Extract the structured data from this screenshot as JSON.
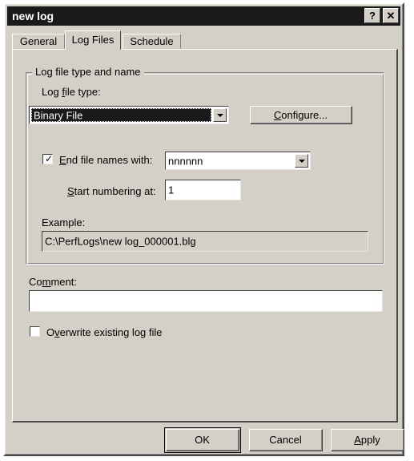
{
  "window": {
    "title": "new log",
    "help_button": "?",
    "close_button": "✕"
  },
  "tabs": [
    {
      "label": "General",
      "selected": false
    },
    {
      "label": "Log Files",
      "selected": true
    },
    {
      "label": "Schedule",
      "selected": false
    }
  ],
  "group": {
    "title": "Log file type and name",
    "log_file_type_label": "Log file type:",
    "log_file_type_value": "Binary File",
    "configure_button": "Configure...",
    "end_file_names_label": "End file names with:",
    "end_file_names_checked": true,
    "suffix_value": "nnnnnn",
    "start_numbering_label": "Start numbering at:",
    "start_numbering_value": "1",
    "example_label": "Example:",
    "example_value": "C:\\PerfLogs\\new log_000001.blg"
  },
  "comment": {
    "label": "Comment:",
    "value": "",
    "placeholder": ""
  },
  "overwrite": {
    "label": "Overwrite existing log file",
    "checked": false
  },
  "buttons": {
    "ok": "OK",
    "cancel": "Cancel",
    "apply": "Apply"
  },
  "colors": {
    "dialog_face": "#d4d0c8",
    "titlebar": "#1a1a1a",
    "titlebar_text": "#ffffff",
    "field_bg": "#ffffff",
    "text": "#000000",
    "selection_bg": "#1a1a1a"
  }
}
